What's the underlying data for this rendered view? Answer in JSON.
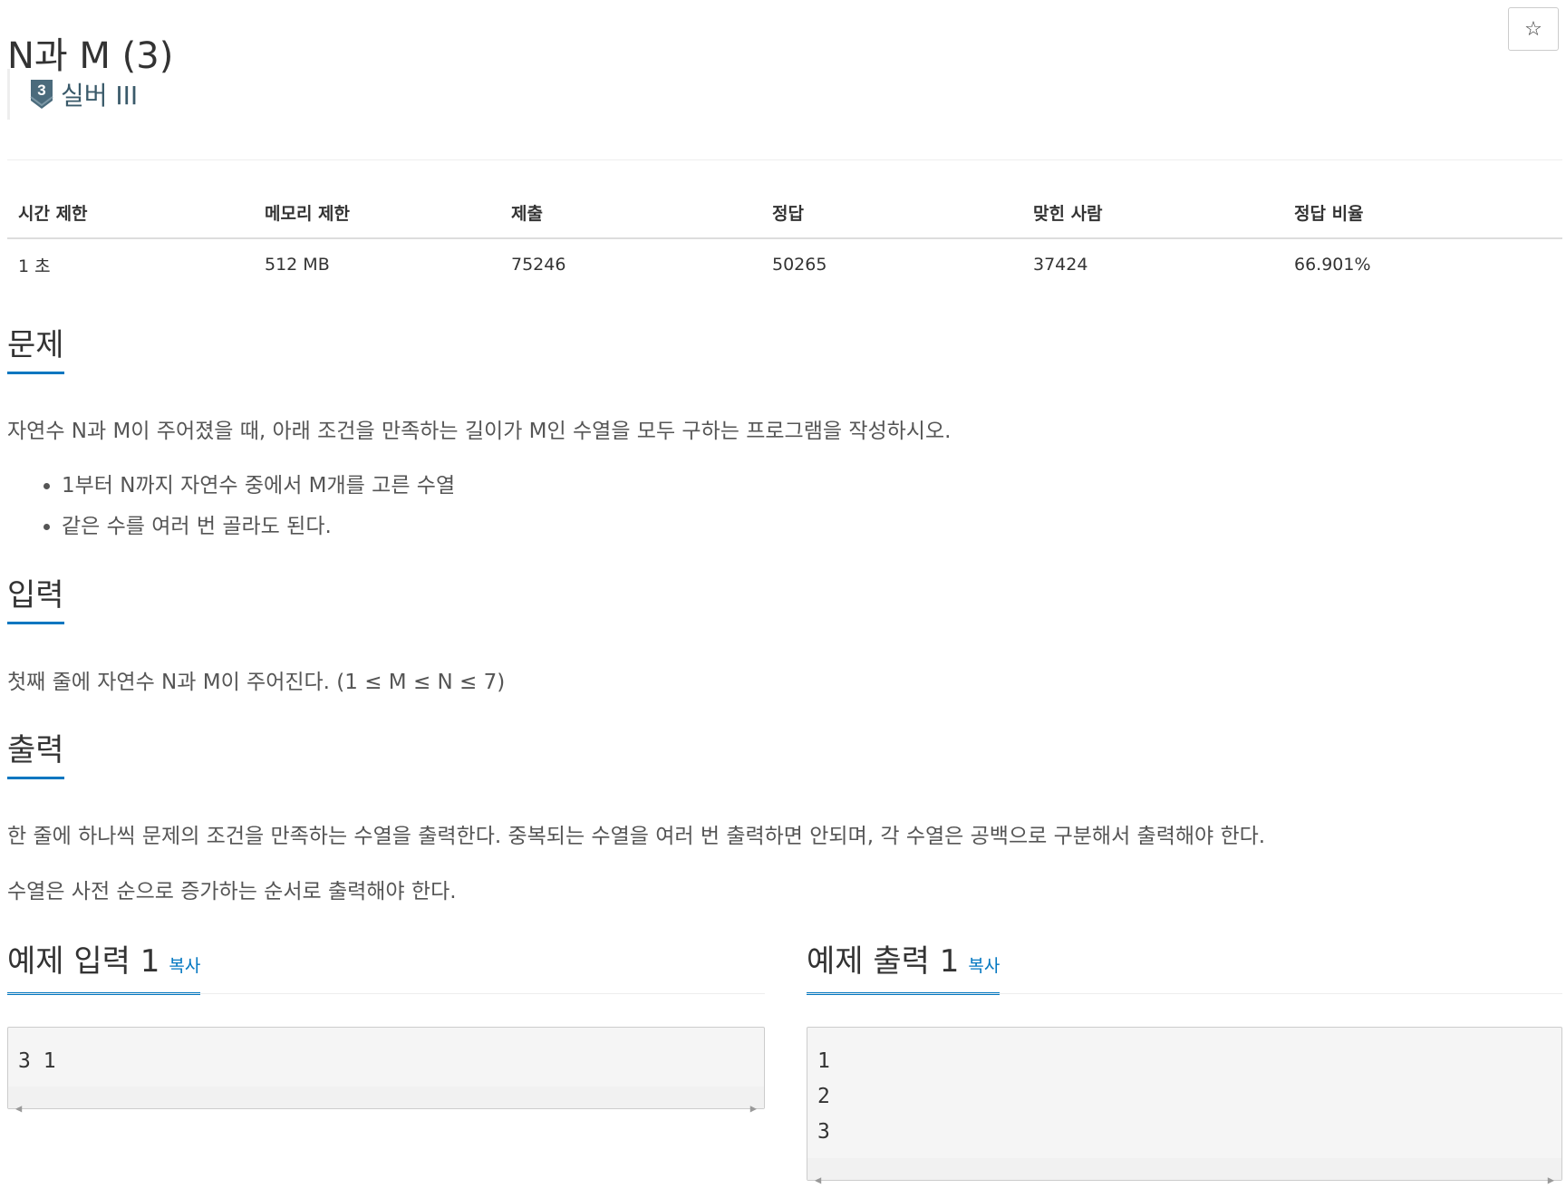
{
  "problem": {
    "title": "N과 M (3)",
    "star_icon": "☆",
    "tier": {
      "number": "3",
      "label": "실버 III",
      "color": "#4b6b7c"
    }
  },
  "info_table": {
    "headers": [
      "시간 제한",
      "메모리 제한",
      "제출",
      "정답",
      "맞힌 사람",
      "정답 비율"
    ],
    "values": [
      "1 초",
      "512 MB",
      "75246",
      "50265",
      "37424",
      "66.901%"
    ]
  },
  "sections": {
    "description": {
      "title": "문제",
      "text": "자연수 N과 M이 주어졌을 때, 아래 조건을 만족하는 길이가 M인 수열을 모두 구하는 프로그램을 작성하시오.",
      "bullets": [
        "1부터 N까지 자연수 중에서 M개를 고른 수열",
        "같은 수를 여러 번 골라도 된다."
      ]
    },
    "input": {
      "title": "입력",
      "text": "첫째 줄에 자연수 N과 M이 주어진다. (1 ≤ M ≤ N ≤ 7)"
    },
    "output": {
      "title": "출력",
      "text1": "한 줄에 하나씩 문제의 조건을 만족하는 수열을 출력한다. 중복되는 수열을 여러 번 출력하면 안되며, 각 수열은 공백으로 구분해서 출력해야 한다.",
      "text2": "수열은 사전 순으로 증가하는 순서로 출력해야 한다."
    }
  },
  "samples": {
    "input": {
      "title": "예제 입력 1",
      "copy_label": "복사",
      "lines": [
        "3 1"
      ]
    },
    "output": {
      "title": "예제 출력 1",
      "copy_label": "복사",
      "lines": [
        "1",
        "2",
        "3"
      ]
    }
  },
  "colors": {
    "accent": "#0076c0",
    "code_bg": "#f5f5f5"
  }
}
